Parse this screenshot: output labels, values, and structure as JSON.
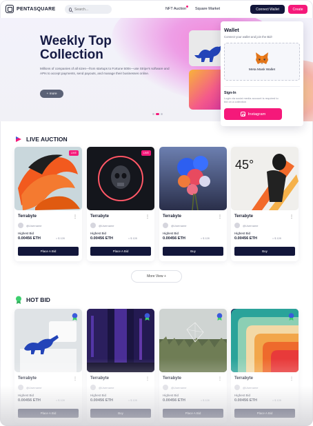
{
  "brand": {
    "name": "PENTASQUARE"
  },
  "search": {
    "placeholder": "Search..."
  },
  "nav": {
    "links": [
      "NFT Auction",
      "Square Market"
    ]
  },
  "header": {
    "connect_wallet": "Connect Wallet",
    "create": "Create"
  },
  "hero": {
    "title": "Weekly Top Collection",
    "description": "Millions of companies of all sizes—from startups to Fortune 500s—use Stripe's software and APIs to accept payments, send payouts, and manage their businesses online.",
    "more_label": "+ more",
    "slide_count": 3,
    "active_slide": 2
  },
  "wallet_popup": {
    "title": "Wallet",
    "subtitle": "Connect your wallet and join the Bid!",
    "metamask_label": "Meta Mask Wallet",
    "signin_title": "Sign-In",
    "signin_subtitle": "Login via social media account is required to bid on a collection",
    "instagram_label": "Instagram"
  },
  "live_auction": {
    "title": "LIVE AUCTION",
    "more_label": "More View +",
    "cards": [
      {
        "name": "Terrabyte",
        "handle": "@Username",
        "bid_label": "Highest Bid",
        "price": "0.00456 ETH",
        "usd": "= $ 128",
        "action": "Place A Bid",
        "badge": "LIVE",
        "image": "orange-tulip-abstract"
      },
      {
        "name": "Terrabyte",
        "handle": "@Username",
        "bid_label": "Highest Bid",
        "price": "0.00456 ETH",
        "usd": "= $ 128",
        "action": "Place A Bid",
        "badge": "LIVE",
        "image": "neon-ring-skull"
      },
      {
        "name": "Terrabyte",
        "handle": "@Username",
        "bid_label": "Highest Bid",
        "price": "0.00456 ETH",
        "usd": "= $ 128",
        "action": "Buy",
        "badge": "",
        "image": "blue-flower-bouquet"
      },
      {
        "name": "Terrabyte",
        "handle": "@Username",
        "bid_label": "Highest Bid",
        "price": "0.00456 ETH",
        "usd": "= $ 128",
        "action": "Buy",
        "badge": "",
        "image": "45-degree-poster",
        "poster_text": "45°"
      }
    ]
  },
  "hot_bid": {
    "title": "HOT BID",
    "cards": [
      {
        "name": "Terrabyte",
        "handle": "@Username",
        "bid_label": "Highest Bid",
        "price": "0.00456 ETH",
        "usd": "= $ 128",
        "action": "Place A Bid",
        "image": "blue-dinosaur-toilet"
      },
      {
        "name": "Terrabyte",
        "handle": "@Username",
        "bid_label": "Highest Bid",
        "price": "0.00456 ETH",
        "usd": "= $ 128",
        "action": "Buy",
        "image": "neon-city-street"
      },
      {
        "name": "Terrabyte",
        "handle": "@Username",
        "bid_label": "Highest Bid",
        "price": "0.00456 ETH",
        "usd": "= $ 128",
        "action": "Place A Bid",
        "image": "wireframe-diamond-grass"
      },
      {
        "name": "Terrabyte",
        "handle": "@Username",
        "bid_label": "Highest Bid",
        "price": "0.00456 ETH",
        "usd": "= $ 128",
        "action": "Place A Bid",
        "image": "retro-rainbow-arcs"
      }
    ]
  },
  "colors": {
    "accent": "#f5197a",
    "navy": "#12163a",
    "text": "#151a2e",
    "muted": "#8a8ea0"
  }
}
